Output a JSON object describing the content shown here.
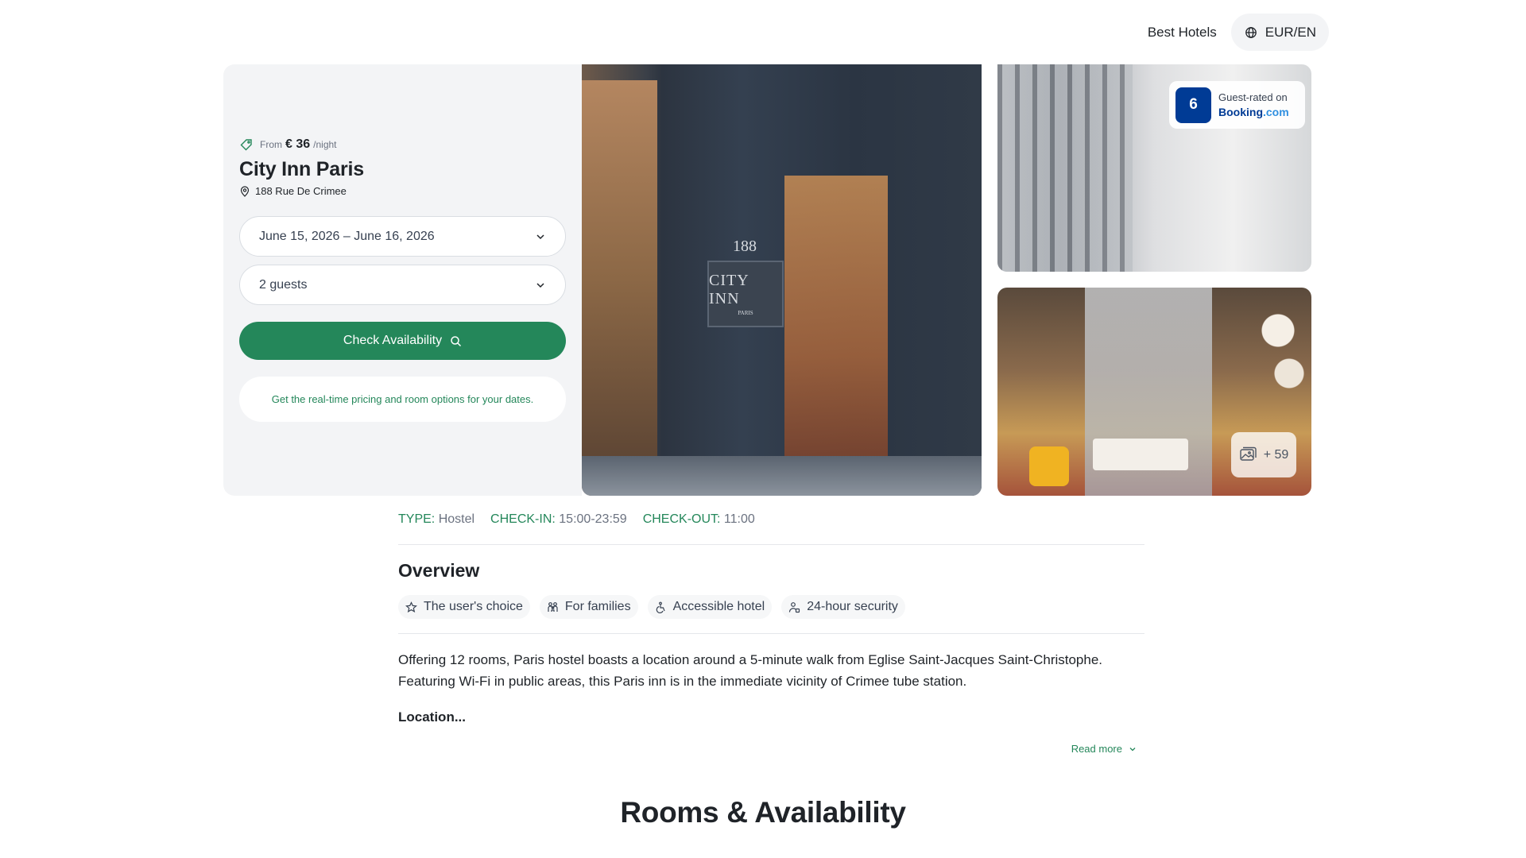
{
  "nav": {
    "best_hotels": "Best Hotels",
    "currency": "EUR/EN"
  },
  "hotel": {
    "from_label": "From",
    "price": "€ 36",
    "per_night": "/night",
    "name": "City Inn Paris",
    "address": "188 Rue De Crimee",
    "dates_value": "June 15, 2026 – June 16, 2026",
    "guests_value": "2 guests",
    "check_button": "Check Availability",
    "info_text": "Get the real-time pricing and room options for your dates."
  },
  "gallery": {
    "main_photo_sign": "CITY INN",
    "main_photo_sign_sub": "PARIS",
    "main_photo_number": "188",
    "rating_score": "6",
    "rating_label": "Guest-rated on",
    "rating_brand_main": "Booking",
    "rating_brand_suffix": ".com",
    "more_photos": "+ 59"
  },
  "details": {
    "type_label": "TYPE:",
    "type_value": "Hostel",
    "checkin_label": "CHECK-IN:",
    "checkin_value": "15:00-23:59",
    "checkout_label": "CHECK-OUT:",
    "checkout_value": "11:00"
  },
  "overview": {
    "title": "Overview",
    "chips": [
      {
        "label": "The user's choice",
        "icon": "star-icon"
      },
      {
        "label": "For families",
        "icon": "family-icon"
      },
      {
        "label": "Accessible hotel",
        "icon": "wheelchair-icon"
      },
      {
        "label": "24-hour security",
        "icon": "security-icon"
      }
    ],
    "description": "Offering 12 rooms, Paris hostel boasts a location around a 5-minute walk from Eglise Saint-Jacques Saint-Christophe. Featuring Wi-Fi in public areas, this Paris inn is in the immediate vicinity of Crimee tube station.",
    "location_heading": "Location...",
    "read_more": "Read more"
  },
  "rooms": {
    "title": "Rooms & Availability"
  },
  "colors": {
    "accent": "#24875a",
    "booking_blue": "#003b95",
    "panel_bg": "#f3f4f6"
  }
}
